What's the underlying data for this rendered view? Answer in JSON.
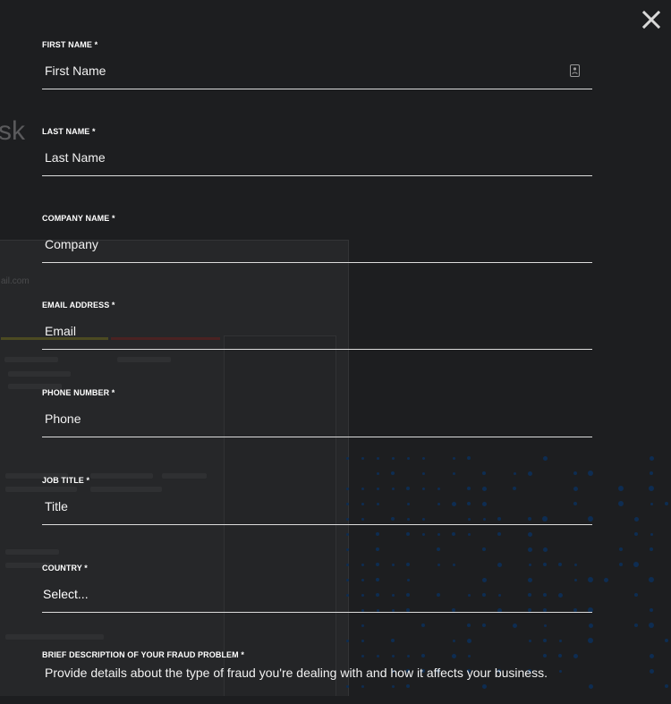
{
  "background": {
    "heading_fragment": "sk",
    "email_fragment": "ail.com"
  },
  "close": {
    "icon": "close-icon"
  },
  "form": {
    "fields": [
      {
        "label": "FIRST NAME *",
        "placeholder": "First Name",
        "value": ""
      },
      {
        "label": "LAST NAME *",
        "placeholder": "Last Name",
        "value": ""
      },
      {
        "label": "COMPANY NAME *",
        "placeholder": "Company",
        "value": ""
      },
      {
        "label": "EMAIL ADDRESS *",
        "placeholder": "Email",
        "value": ""
      },
      {
        "label": "PHONE NUMBER *",
        "placeholder": "Phone",
        "value": ""
      },
      {
        "label": "JOB TITLE *",
        "placeholder": "Title",
        "value": ""
      }
    ],
    "country": {
      "label": "COUNTRY *",
      "selected": "Select..."
    },
    "description": {
      "label": "BRIEF DESCRIPTION OF YOUR FRAUD PROBLEM *",
      "placeholder": "Provide details about the type of fraud you're dealing with and how it affects your business."
    }
  }
}
